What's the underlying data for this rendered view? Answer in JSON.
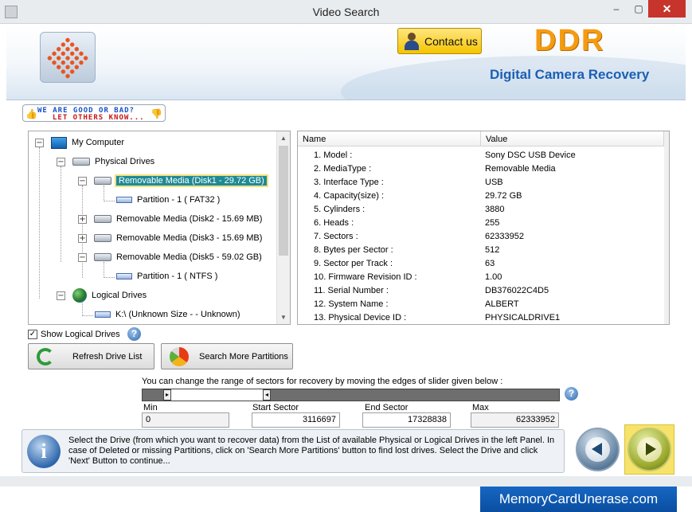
{
  "window": {
    "title": "Video Search",
    "minimize_glyph": "–",
    "maximize_glyph": "▢",
    "close_glyph": "✕"
  },
  "header": {
    "contact_label": "Contact us",
    "brand": "DDR",
    "product_name": "Digital Camera Recovery"
  },
  "feedback": {
    "line1": "WE ARE GOOD OR BAD?",
    "line2": "LET OTHERS KNOW...",
    "thumb_up_icon": "👍",
    "thumb_down_icon": "👎"
  },
  "tree": {
    "root": "My Computer",
    "physical_group": "Physical Drives",
    "drives": [
      {
        "label": "Removable Media (Disk1 - 29.72 GB)",
        "expanded": true
      },
      {
        "label": "Partition - 1 ( FAT32 )"
      },
      {
        "label": "Removable Media (Disk2 - 15.69 MB)",
        "expanded": false
      },
      {
        "label": "Removable Media (Disk3 - 15.69 MB)",
        "expanded": false
      },
      {
        "label": "Removable Media (Disk5 - 59.02 GB)",
        "expanded": true
      },
      {
        "label": "Partition - 1 ( NTFS )"
      }
    ],
    "logical_group": "Logical Drives",
    "logical_items": [
      {
        "label": "K:\\ (Unknown Size  -  - Unknown)"
      }
    ],
    "expander_minus": "−",
    "expander_plus": "+"
  },
  "properties": {
    "headers": [
      "Name",
      "Value"
    ],
    "rows": [
      {
        "name": "1. Model :",
        "value": "Sony DSC USB Device"
      },
      {
        "name": "2. MediaType :",
        "value": "Removable Media"
      },
      {
        "name": "3. Interface Type :",
        "value": "USB"
      },
      {
        "name": "4. Capacity(size) :",
        "value": "29.72 GB"
      },
      {
        "name": "5. Cylinders :",
        "value": "3880"
      },
      {
        "name": "6. Heads :",
        "value": "255"
      },
      {
        "name": "7. Sectors :",
        "value": "62333952"
      },
      {
        "name": "8. Bytes per Sector :",
        "value": "512"
      },
      {
        "name": "9. Sector per Track :",
        "value": "63"
      },
      {
        "name": "10. Firmware Revision ID :",
        "value": "1.00"
      },
      {
        "name": "11. Serial Number :",
        "value": "DB376022C4D5"
      },
      {
        "name": "12. System Name :",
        "value": "ALBERT"
      },
      {
        "name": "13. Physical Device ID :",
        "value": "PHYSICALDRIVE1"
      }
    ]
  },
  "controls": {
    "show_logical_label": "Show Logical Drives",
    "show_logical_checked": "✓",
    "help_glyph": "?",
    "refresh_label": "Refresh Drive List",
    "search_label": "Search More Partitions"
  },
  "sectors": {
    "instruction": "You can change the range of sectors for recovery by moving the edges of slider given below :",
    "handle_left_glyph": "▸",
    "handle_right_glyph": "◂",
    "min_label": "Min",
    "min_value": "0",
    "start_label": "Start Sector",
    "start_value": "3116697",
    "end_label": "End Sector",
    "end_value": "17328838",
    "max_label": "Max",
    "max_value": "62333952"
  },
  "info": {
    "icon_glyph": "i",
    "text": "Select the Drive (from which you want to recover data) from the List of available Physical or Logical Drives in the left Panel. In case of Deleted or missing Partitions, click on 'Search More Partitions' button to find lost drives. Select the Drive and click 'Next' Button to continue..."
  },
  "footer": {
    "site": "MemoryCardUnerase.com"
  },
  "colors": {
    "accent": "#1a5fb4",
    "brand": "#f59b12",
    "selection": "#1f8a96",
    "next_highlight": "#f7e26a"
  }
}
